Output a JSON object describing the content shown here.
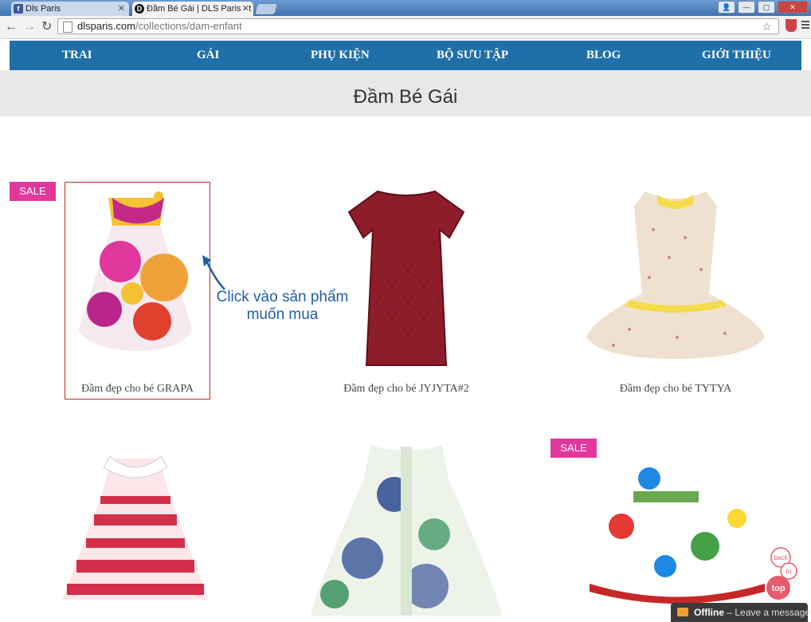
{
  "browser": {
    "tabs": [
      {
        "title": "Dls Paris",
        "favicon": "facebook-icon",
        "active": false
      },
      {
        "title": "Đầm Bé Gái | DLS Paris - t",
        "favicon": "dls-icon",
        "active": true
      }
    ],
    "url_host": "dlsparis.com",
    "url_path": "/collections/dam-enfant"
  },
  "nav": {
    "items": [
      "TRAI",
      "GÁI",
      "PHỤ KIỆN",
      "BỘ SƯU TẬP",
      "BLOG",
      "GIỚI THIỆU"
    ],
    "color": "#1f6fa8"
  },
  "page": {
    "title": "Đầm Bé Gái"
  },
  "sale_label": "SALE",
  "products": [
    {
      "title": "Đầm đẹp cho bé GRAPA",
      "sale": true
    },
    {
      "title": "Đầm đẹp cho bé JYJYTA#2",
      "sale": false
    },
    {
      "title": "Đầm đẹp cho bé TYTYA",
      "sale": false
    },
    {
      "title": "",
      "sale": false
    },
    {
      "title": "",
      "sale": false
    },
    {
      "title": "",
      "sale": true
    }
  ],
  "annotation": {
    "line1": "Click vào sản phẩm",
    "line2": "muốn mua"
  },
  "chat": {
    "status": "Offline",
    "message": "Leave a message"
  },
  "back_to_top": {
    "line1": "back",
    "line2": "to",
    "line3": "top"
  },
  "colors": {
    "sale": "#e0389c",
    "accent": "#1f6fa8",
    "highlight": "#c62828"
  }
}
